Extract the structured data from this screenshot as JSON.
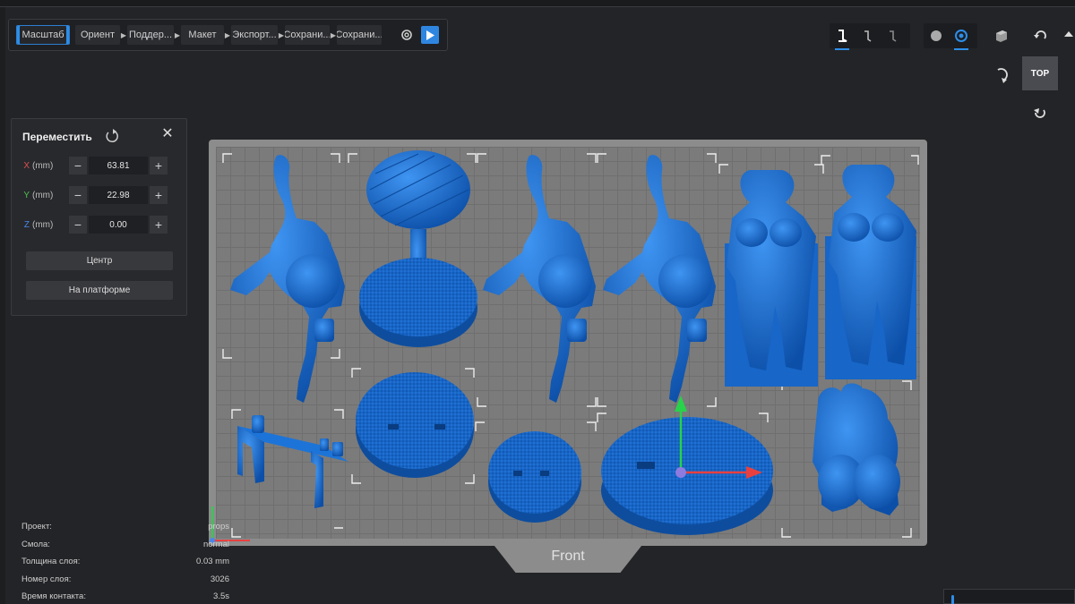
{
  "workflow": {
    "steps": [
      "Масштаб",
      "Ориент",
      "Поддер...",
      "Макет",
      "Экспорт...",
      "Сохрани...",
      "Сохрани..."
    ],
    "active_step": "Масштаб"
  },
  "toolbar": {
    "view_label": "TOP",
    "accent_color": "#2d8ee8"
  },
  "move_panel": {
    "title": "Переместить",
    "x": {
      "axis": "X",
      "unit": "(mm)",
      "value": "63.81",
      "color": "#e05050"
    },
    "y": {
      "axis": "Y",
      "unit": "(mm)",
      "value": "22.98",
      "color": "#4cc24c"
    },
    "z": {
      "axis": "Z",
      "unit": "(mm)",
      "value": "0.00",
      "color": "#4a86e8"
    },
    "center_button": "Центр",
    "platform_button": "На платформе"
  },
  "plate": {
    "front_label": "Front",
    "model_color": "#1a6fd6"
  },
  "info": {
    "project_label": "Проект:",
    "project_value": "props",
    "resin_label": "Смола:",
    "resin_value": "normal",
    "layer_thickness_label": "Толщина слоя:",
    "layer_thickness_value": "0.03 mm",
    "layer_count_label": "Номер слоя:",
    "layer_count_value": "3026",
    "exposure_label": "Время контакта:",
    "exposure_value": "3.5s"
  }
}
